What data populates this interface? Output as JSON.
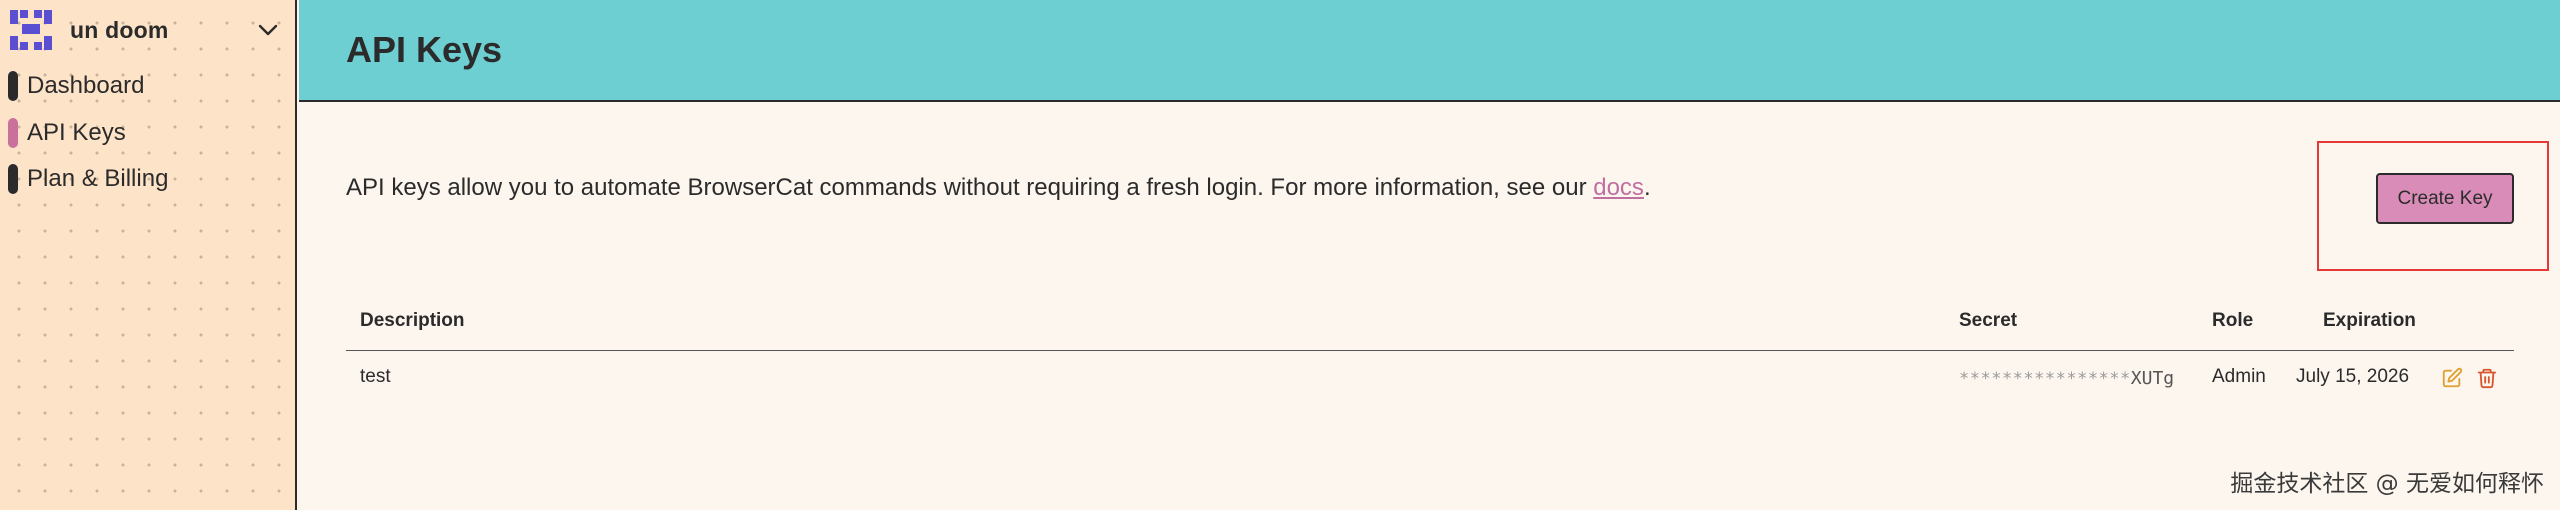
{
  "sidebar": {
    "org_name": "un doom",
    "nav": [
      {
        "label": "Dashboard",
        "active": false
      },
      {
        "label": "API Keys",
        "active": true
      },
      {
        "label": "Plan & Billing",
        "active": false
      }
    ]
  },
  "header": {
    "title": "API Keys"
  },
  "main": {
    "intro_text": "API keys allow you to automate BrowserCat commands without requiring a fresh login. For more information, see our ",
    "intro_link": "docs",
    "intro_end": ".",
    "create_button": "Create Key"
  },
  "table": {
    "columns": [
      "Description",
      "Secret",
      "Role",
      "Expiration"
    ],
    "rows": [
      {
        "description": "test",
        "secret_mask": "****************",
        "secret_tail": "XUTg",
        "role": "Admin",
        "expiration": "July 15, 2026"
      }
    ]
  },
  "colors": {
    "header_bg": "#6ecfd2",
    "sidebar_bg": "#fde3c8",
    "accent_pink": "#d98cb8",
    "active_pill": "#c9719c",
    "edit_icon": "#e0a030",
    "delete_icon": "#d9552f"
  },
  "watermark": "掘金技术社区 @ 无爱如何释怀"
}
